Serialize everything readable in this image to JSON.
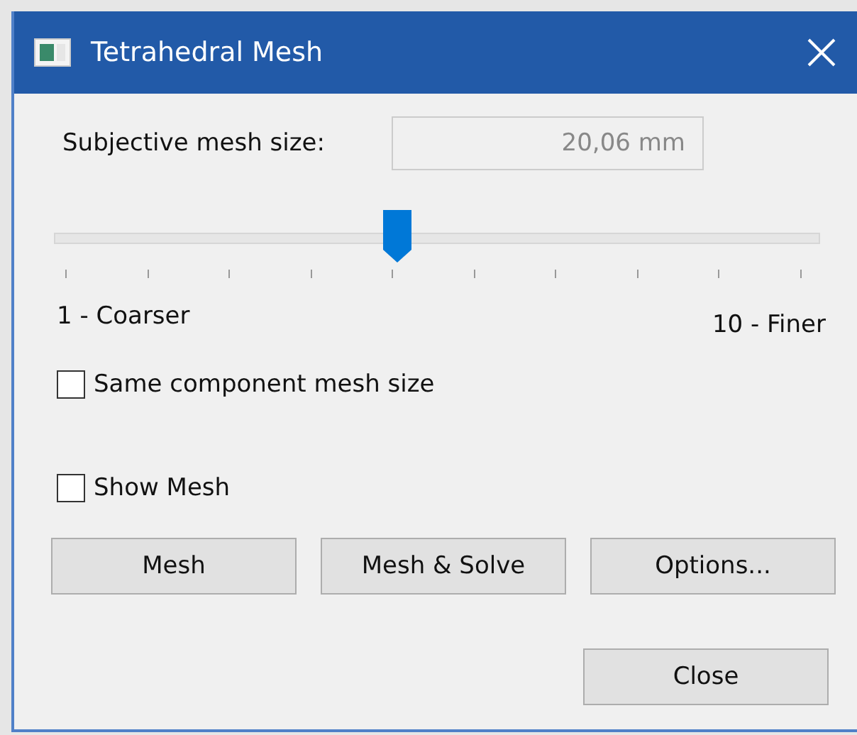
{
  "window": {
    "title": "Tetrahedral Mesh"
  },
  "mesh_size": {
    "label": "Subjective mesh size:",
    "value": "20,06 mm",
    "disabled": true
  },
  "slider": {
    "level": 0.444,
    "min_label": "1 - Coarser",
    "max_label": "10 - Finer"
  },
  "checkboxes": [
    {
      "label": "Same component mesh size",
      "checked": false
    },
    {
      "label": "Show Mesh",
      "checked": false
    }
  ],
  "buttons": [
    "Mesh",
    "Mesh & Solve",
    "Options..."
  ],
  "close_button": "Close"
}
